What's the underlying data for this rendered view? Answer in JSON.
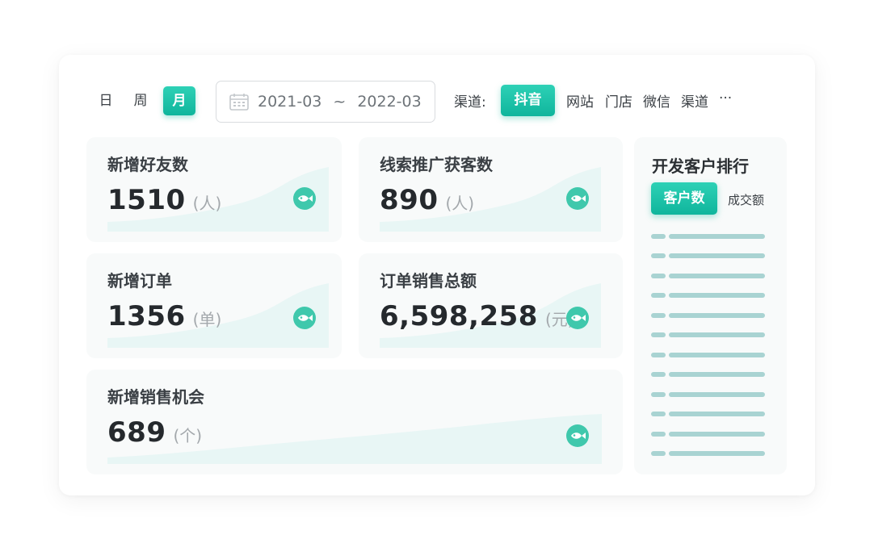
{
  "toolbar": {
    "periods": [
      "日",
      "周",
      "月"
    ],
    "date_start": "2021-03",
    "date_sep": "~",
    "date_end": "2022-03",
    "channel_label": "渠道:",
    "channels": [
      "抖音",
      "网站",
      "门店",
      "微信",
      "渠道",
      "···"
    ]
  },
  "stats": [
    {
      "title": "新增好友数",
      "value": "1510",
      "unit": "(人)"
    },
    {
      "title": "线索推广获客数",
      "value": "890",
      "unit": "(人)"
    },
    {
      "title": "新增订单",
      "value": "1356",
      "unit": "(单)"
    },
    {
      "title": "订单销售总额",
      "value": "6,598,258",
      "unit": "(元)"
    },
    {
      "title": "新增销售机会",
      "value": "689",
      "unit": "(个)"
    }
  ],
  "ranking": {
    "title": "开发客户排行",
    "tabs": [
      "客户数",
      "成交额"
    ]
  },
  "colors": {
    "accent": "#14bca0",
    "card_bg": "#f8fafa",
    "sparkline_fill": "#e8f6f5",
    "rank_bar": "#a9d3d2"
  },
  "icons": {
    "date": "calendar-icon",
    "stat": "fish-icon"
  }
}
